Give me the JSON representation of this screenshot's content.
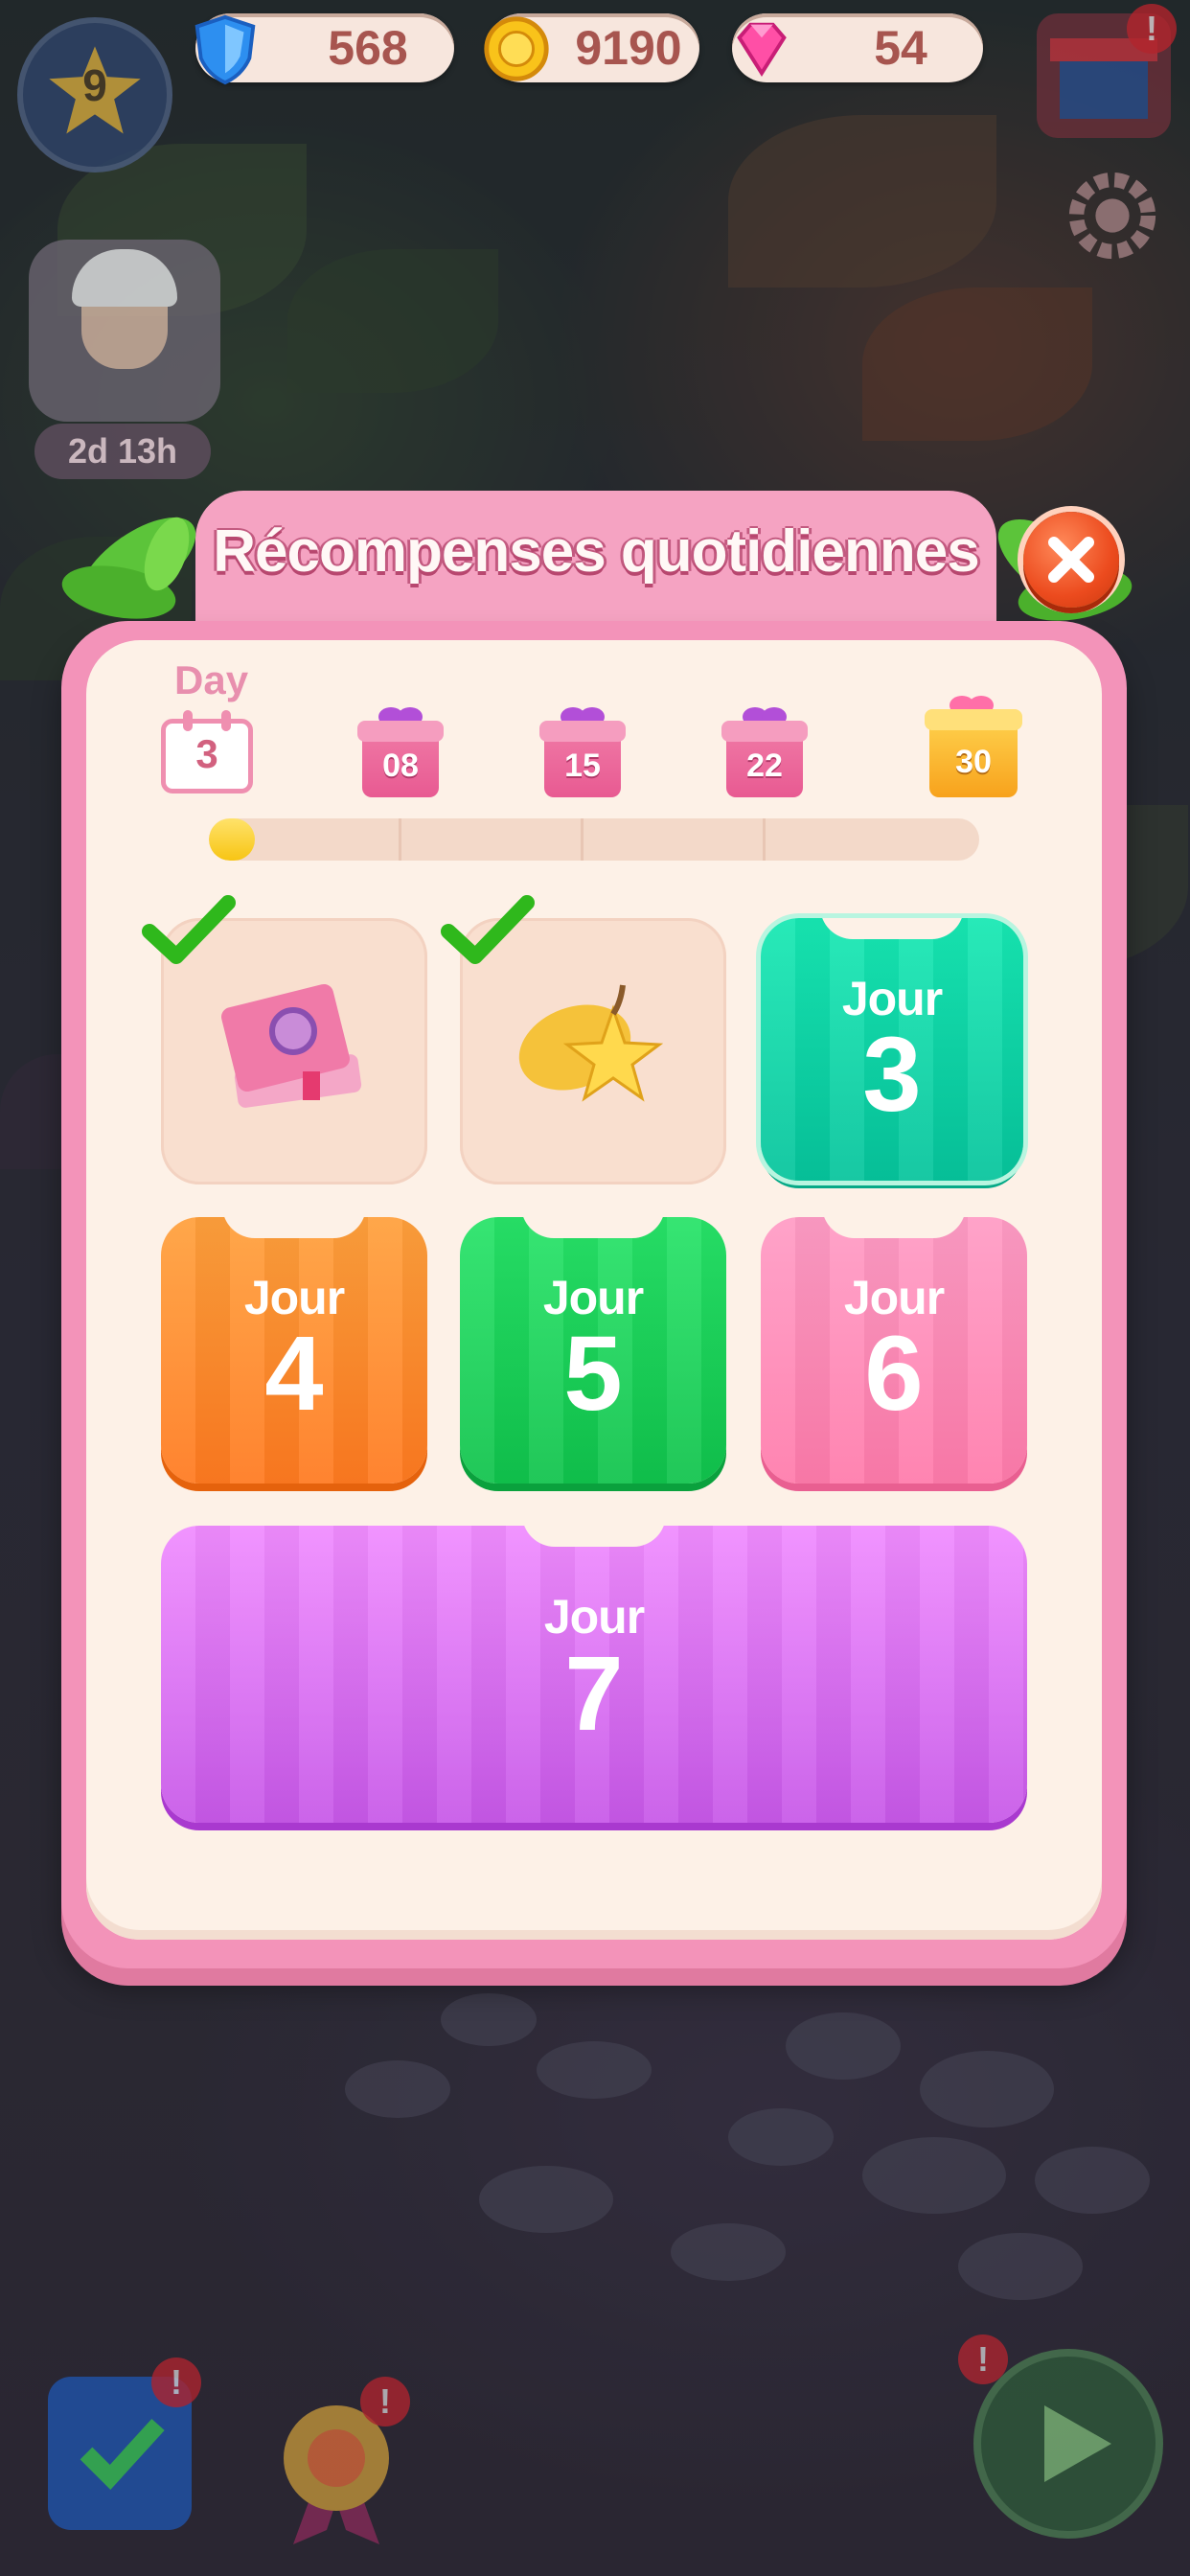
{
  "hud": {
    "level": "9",
    "shields": "568",
    "coins": "9190",
    "gems": "54",
    "event_timer": "2d 13h",
    "shop_alert": "!",
    "tasks_alert": "!",
    "badge_alert": "!",
    "play_alert": "!"
  },
  "modal": {
    "title": "Récompenses quotidiennes",
    "day_label": "Day",
    "current_day": "3",
    "milestones": [
      "08",
      "15",
      "22",
      "30"
    ],
    "progress": 0.06,
    "cards": [
      {
        "state": "claimed",
        "reward": "book-reward"
      },
      {
        "state": "claimed",
        "reward": "star-fruit-reward"
      },
      {
        "label": "Jour",
        "day": "3",
        "color": "#11dca9"
      },
      {
        "label": "Jour",
        "day": "4",
        "color": "#ff8c2e"
      },
      {
        "label": "Jour",
        "day": "5",
        "color": "#1bd95b"
      },
      {
        "label": "Jour",
        "day": "6",
        "color": "#ff8dba"
      },
      {
        "label": "Jour",
        "day": "7",
        "color": "#dc72f5"
      }
    ]
  },
  "colors": {
    "modal_frame": "#f393b9",
    "modal_body": "#fdf1e7",
    "title_text": "#fff8f6",
    "progress_fill": "#f7c514",
    "close_button": "#ec4b1e"
  }
}
